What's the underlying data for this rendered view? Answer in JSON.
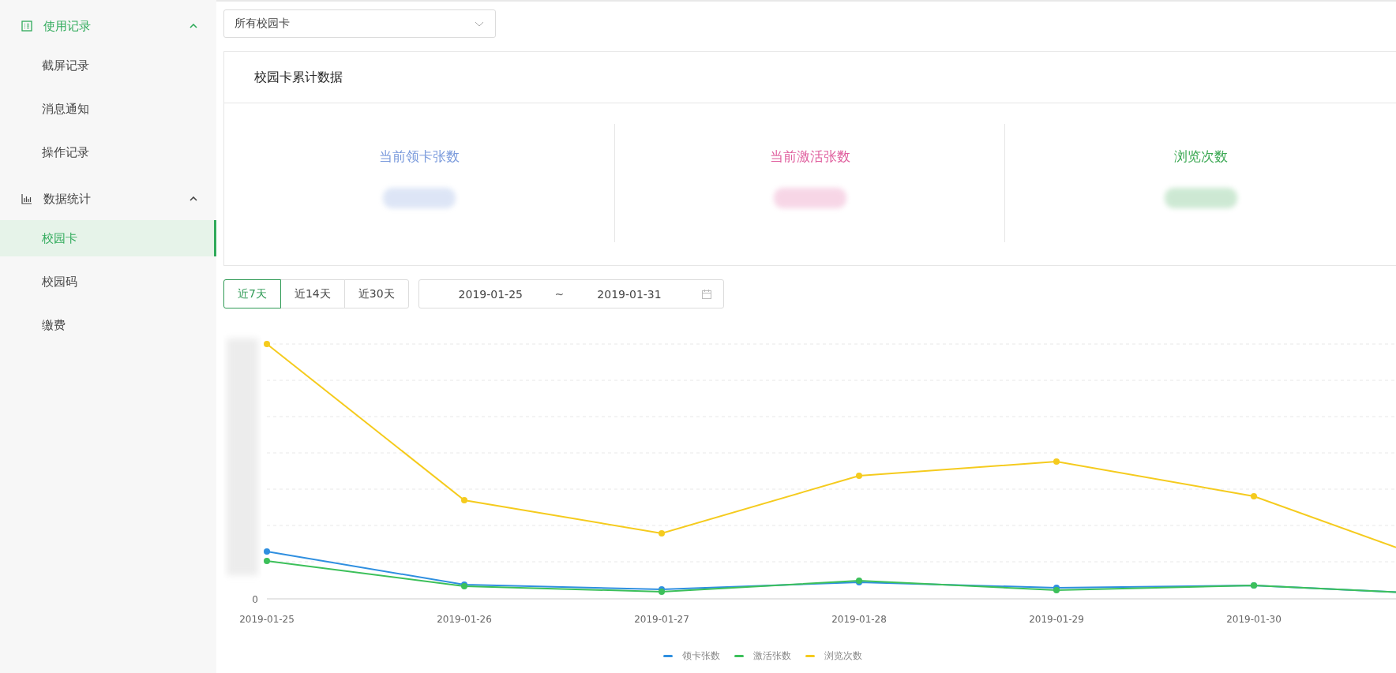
{
  "sidebar": {
    "groups": [
      {
        "label": "使用记录",
        "active": true,
        "expanded": true,
        "children": [
          {
            "label": "截屏记录",
            "selected": false
          },
          {
            "label": "消息通知",
            "selected": false
          },
          {
            "label": "操作记录",
            "selected": false
          }
        ]
      },
      {
        "label": "数据统计",
        "active": false,
        "expanded": true,
        "children": [
          {
            "label": "校园卡",
            "selected": true
          },
          {
            "label": "校园码",
            "selected": false
          },
          {
            "label": "缴费",
            "selected": false
          }
        ]
      }
    ]
  },
  "card_select": {
    "value": "所有校园卡"
  },
  "summary": {
    "title": "校园卡累计数据",
    "stats": [
      {
        "label": "当前领卡张数",
        "color": "#7b9bdc"
      },
      {
        "label": "当前激活张数",
        "color": "#e0609f"
      },
      {
        "label": "浏览次数",
        "color": "#3ba853"
      }
    ]
  },
  "range_tabs": [
    {
      "label": "近7天",
      "selected": true
    },
    {
      "label": "近14天",
      "selected": false
    },
    {
      "label": "近30天",
      "selected": false
    }
  ],
  "date_range": {
    "start": "2019-01-25",
    "separator": "~",
    "end": "2019-01-31"
  },
  "chart": {
    "y_zero": "0",
    "x_labels": [
      "2019-01-25",
      "2019-01-26",
      "2019-01-27",
      "2019-01-28",
      "2019-01-29",
      "2019-01-30"
    ],
    "legend": [
      {
        "label": "领卡张数",
        "color": "#2f8fe0"
      },
      {
        "label": "激活张数",
        "color": "#3cc05a"
      },
      {
        "label": "浏览次数",
        "color": "#f5cb1e"
      }
    ]
  }
}
